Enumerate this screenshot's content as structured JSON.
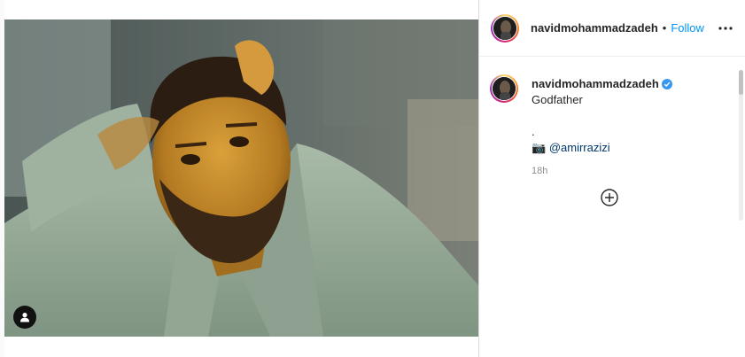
{
  "post": {
    "author": "navidmohammadzadeh",
    "separator": "•",
    "follow_label": "Follow",
    "more_icon": "more-horizontal-icon"
  },
  "caption": {
    "author": "navidmohammadzadeh",
    "verified": true,
    "lines": [
      "Godfather",
      "",
      "."
    ],
    "credit_icon": "📷",
    "mention": "@amirrazizi",
    "time": "18h"
  },
  "media": {
    "user_tag_icon": "user-tag-icon"
  },
  "colors": {
    "accent": "#0095f6",
    "mention": "#00376b",
    "muted": "#8e8e8e",
    "verified": "#3897f0"
  }
}
